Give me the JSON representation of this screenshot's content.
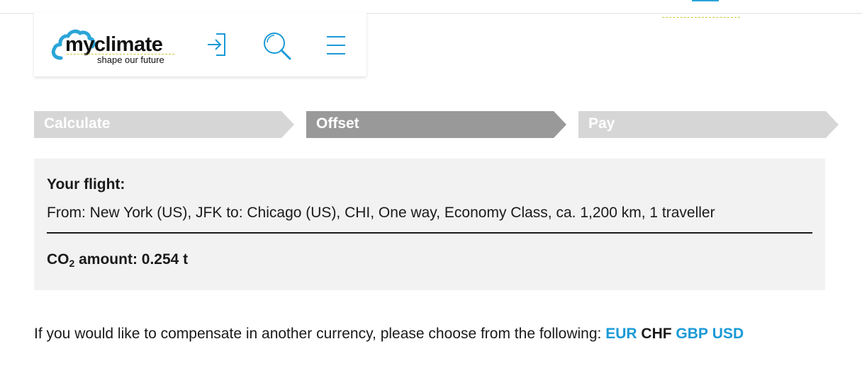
{
  "header": {
    "logo": {
      "word": "myclimate",
      "tagline": "shape our future"
    },
    "icons": {
      "login": "login-icon",
      "search": "search-icon",
      "menu": "menu-icon"
    },
    "accent_color": "#1a9ad6"
  },
  "steps": [
    {
      "label": "Calculate",
      "state": "done"
    },
    {
      "label": "Offset",
      "state": "active"
    },
    {
      "label": "Pay",
      "state": "upcoming"
    }
  ],
  "summary": {
    "title": "Your flight:",
    "route": "From: New York (US), JFK to: Chicago (US), CHI, One way, Economy Class, ca. 1,200 km, 1 traveller",
    "co2_prefix": "CO",
    "co2_sub": "2",
    "co2_rest": " amount: 0.254 t"
  },
  "currency": {
    "prompt": "If you would like to compensate in another currency, please choose from the following: ",
    "options": [
      "EUR",
      "CHF",
      "GBP",
      "USD"
    ],
    "selected": "CHF"
  }
}
